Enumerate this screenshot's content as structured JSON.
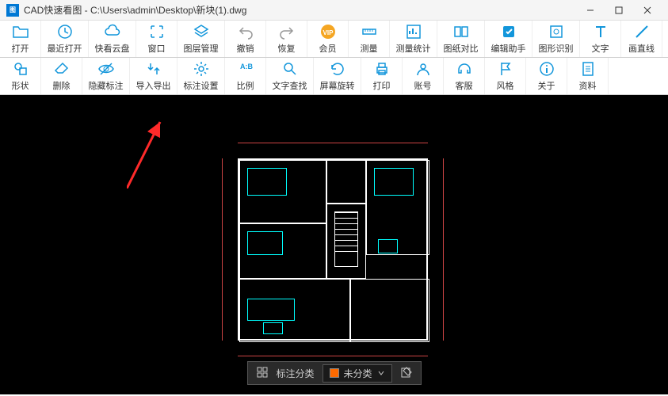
{
  "title": "CAD快速看图 - C:\\Users\\admin\\Desktop\\新块(1).dwg",
  "appIconText": "图",
  "row1": [
    {
      "label": "打开",
      "name": "open-button",
      "icon": "folder"
    },
    {
      "label": "最近打开",
      "name": "recent-button",
      "icon": "clock",
      "wide": true
    },
    {
      "label": "快看云盘",
      "name": "cloud-button",
      "icon": "cloud",
      "wide": true
    },
    {
      "label": "窗口",
      "name": "window-button",
      "icon": "expand"
    },
    {
      "label": "图层管理",
      "name": "layer-button",
      "icon": "layers",
      "wide": true
    },
    {
      "label": "撤销",
      "name": "undo-button",
      "icon": "undo",
      "gray": true
    },
    {
      "label": "恢复",
      "name": "redo-button",
      "icon": "redo",
      "gray": true
    },
    {
      "label": "会员",
      "name": "vip-button",
      "icon": "vip",
      "gold": true
    },
    {
      "label": "测量",
      "name": "measure-button",
      "icon": "ruler"
    },
    {
      "label": "测量统计",
      "name": "measure-stat-button",
      "icon": "stat",
      "wide": true
    },
    {
      "label": "图纸对比",
      "name": "compare-button",
      "icon": "compare",
      "wide": true
    },
    {
      "label": "编辑助手",
      "name": "edit-helper-button",
      "icon": "edit",
      "wide": true
    },
    {
      "label": "图形识别",
      "name": "shape-detect-button",
      "icon": "detect",
      "wide": true
    },
    {
      "label": "文字",
      "name": "text-button",
      "icon": "text"
    },
    {
      "label": "画直线",
      "name": "line-button",
      "icon": "line"
    }
  ],
  "row2": [
    {
      "label": "形状",
      "name": "shape-button",
      "icon": "shape"
    },
    {
      "label": "删除",
      "name": "delete-button",
      "icon": "eraser"
    },
    {
      "label": "隐藏标注",
      "name": "hide-anno-button",
      "icon": "eye",
      "wide": true
    },
    {
      "label": "导入导出",
      "name": "import-export-button",
      "icon": "io",
      "wide": true
    },
    {
      "label": "标注设置",
      "name": "anno-set-button",
      "icon": "gear",
      "wide": true
    },
    {
      "label": "比例",
      "name": "scale-button",
      "icon": "ab"
    },
    {
      "label": "文字查找",
      "name": "find-text-button",
      "icon": "search",
      "wide": true
    },
    {
      "label": "屏幕旋转",
      "name": "rotate-button",
      "icon": "rotate",
      "wide": true
    },
    {
      "label": "打印",
      "name": "print-button",
      "icon": "print"
    },
    {
      "label": "账号",
      "name": "account-button",
      "icon": "user"
    },
    {
      "label": "客服",
      "name": "support-button",
      "icon": "headset"
    },
    {
      "label": "风格",
      "name": "style-button",
      "icon": "flag"
    },
    {
      "label": "关于",
      "name": "about-button",
      "icon": "info"
    },
    {
      "label": "资料",
      "name": "data-button",
      "icon": "doc"
    }
  ],
  "bottom": {
    "labelPrefix": "标注分类",
    "current": "未分类"
  }
}
